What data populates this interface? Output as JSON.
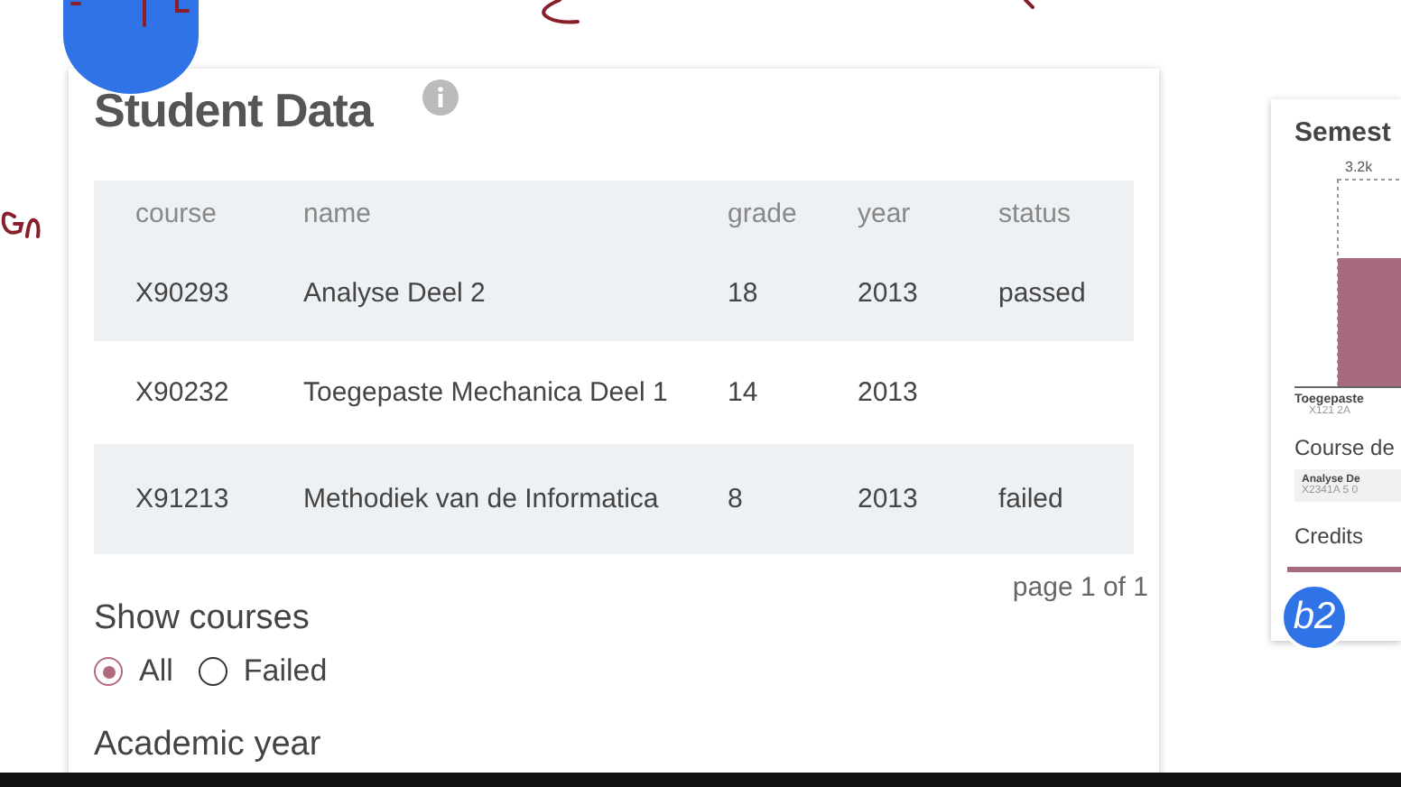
{
  "student_card": {
    "title": "Student Data",
    "table": {
      "columns": [
        "course",
        "name",
        "grade",
        "year",
        "status"
      ],
      "rows": [
        {
          "course": "X90293",
          "name": "Analyse Deel 2",
          "grade": "18",
          "year": "2013",
          "status": "passed"
        },
        {
          "course": "X90232",
          "name": "Toegepaste Mechanica Deel 1",
          "grade": "14",
          "year": "2013"
        },
        {
          "course": "X91213",
          "name": "Methodiek van de Informatica",
          "grade": "8",
          "year": "2013",
          "status": "failed"
        }
      ]
    },
    "pager": "page 1 of 1",
    "filter": {
      "label": "Show courses",
      "options": [
        {
          "label": "All",
          "selected": true
        },
        {
          "label": "Failed",
          "selected": false
        }
      ]
    },
    "next_section": "Academic year"
  },
  "side_card": {
    "title": "Semest",
    "bar_label": "3.2k",
    "bar_caption": "Toegepaste",
    "bar_sublabel": "X121 2A",
    "section": "Course de",
    "course_chip": {
      "name": "Analyse De",
      "code": "X2341A 5 0"
    },
    "credits_label": "Credits"
  },
  "badge": "b2"
}
